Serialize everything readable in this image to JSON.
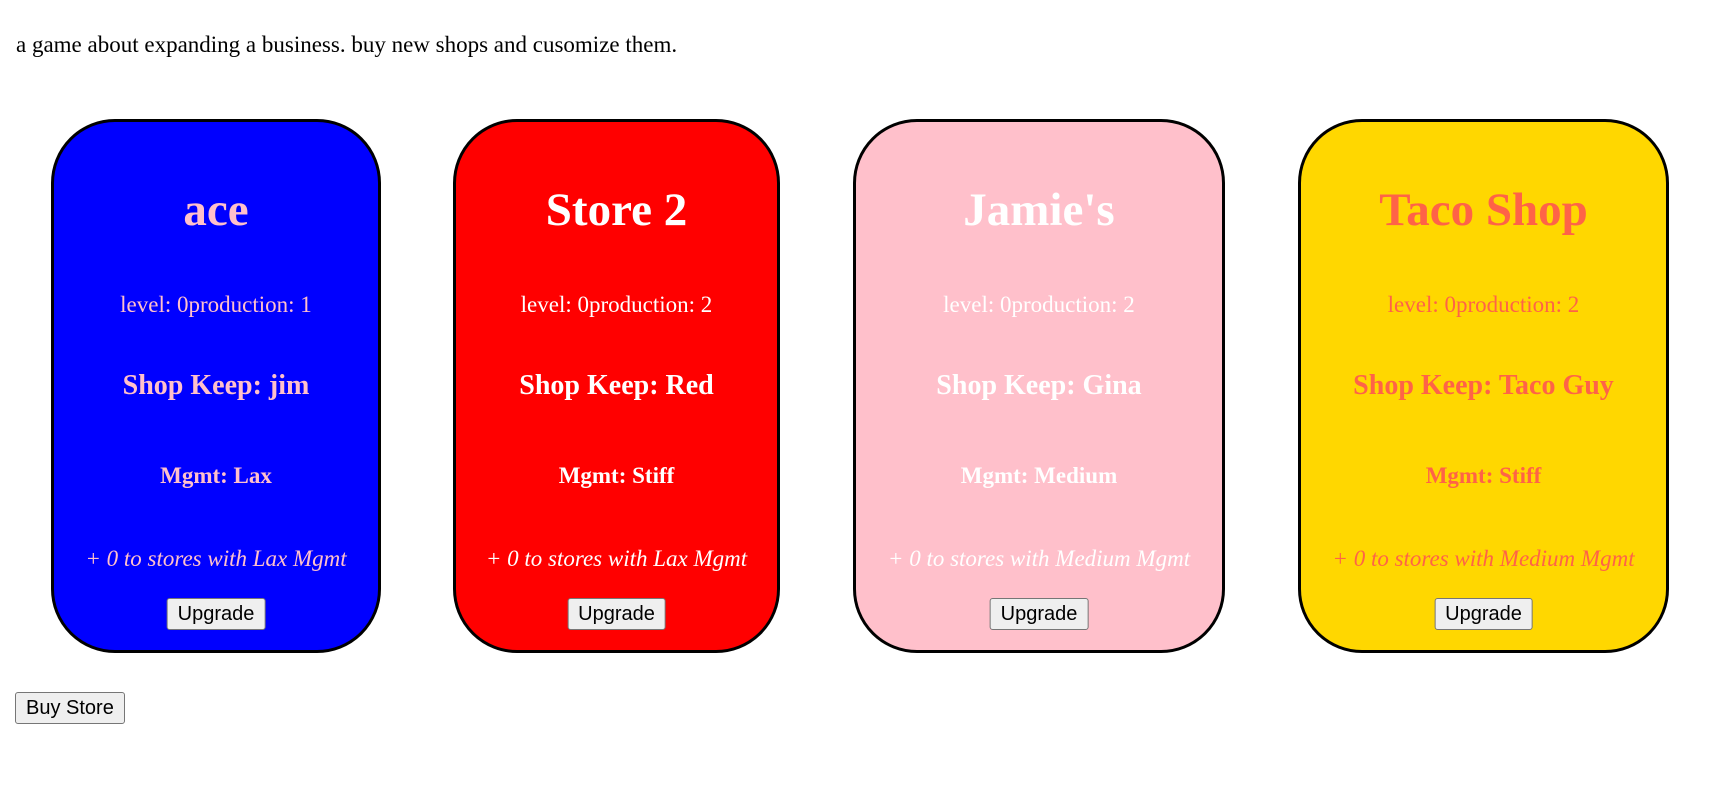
{
  "intro_text": "a game about expanding a business. buy new shops and cusomize them.",
  "stores": [
    {
      "name": "ace",
      "stats": "level: 0production: 1",
      "shop_keep": "Shop Keep: jim",
      "mgmt": "Mgmt: Lax",
      "bonus": "+ 0 to stores with Lax Mgmt",
      "upgrade_label": "Upgrade",
      "background_color": "#0000ff",
      "text_color": "#ffc0cb"
    },
    {
      "name": "Store 2",
      "stats": "level: 0production: 2",
      "shop_keep": "Shop Keep: Red",
      "mgmt": "Mgmt: Stiff",
      "bonus": "+ 0 to stores with Lax Mgmt",
      "upgrade_label": "Upgrade",
      "background_color": "#ff0000",
      "text_color": "#ffffff"
    },
    {
      "name": "Jamie's",
      "stats": "level: 0production: 2",
      "shop_keep": "Shop Keep: Gina",
      "mgmt": "Mgmt: Medium",
      "bonus": "+ 0 to stores with Medium Mgmt",
      "upgrade_label": "Upgrade",
      "background_color": "#ffc0cb",
      "text_color": "#ffffff"
    },
    {
      "name": "Taco Shop",
      "stats": "level: 0production: 2",
      "shop_keep": "Shop Keep: Taco Guy",
      "mgmt": "Mgmt: Stiff",
      "bonus": "+ 0 to stores with Medium Mgmt",
      "upgrade_label": "Upgrade",
      "background_color": "#ffd700",
      "text_color": "#ff6347"
    }
  ],
  "buy_store_label": "Buy Store"
}
